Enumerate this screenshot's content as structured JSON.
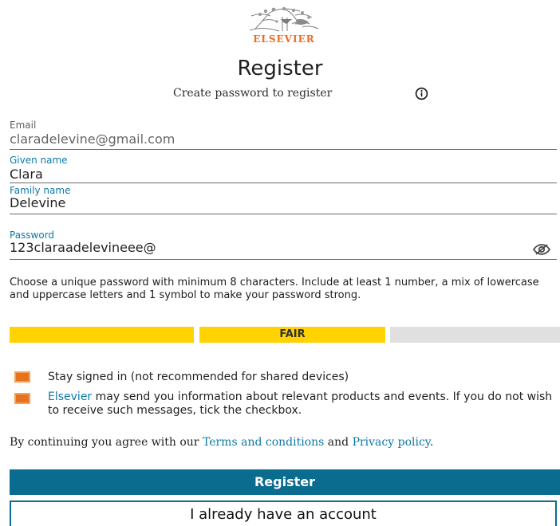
{
  "brand": {
    "name": "ELSEVIER",
    "logo_icon": "elsevier-tree-logo"
  },
  "header": {
    "title": "Register",
    "subtitle": "Create password to register"
  },
  "form": {
    "email": {
      "label": "Email",
      "value": "claradelevine@gmail.com"
    },
    "given_name": {
      "label": "Given name",
      "value": "Clara"
    },
    "family_name": {
      "label": "Family name",
      "value": "Delevine"
    },
    "password": {
      "label": "Password",
      "value": "123claraadelevineee@"
    }
  },
  "password_hint": "Choose a unique password with minimum 8 characters. Include at least 1 number, a mix of lowercase and uppercase letters and 1 symbol to make your password strong.",
  "password_strength": {
    "label": "FAIR",
    "active_segments": 2,
    "total_segments": 3,
    "color": "#ffd200",
    "empty_color": "#e0e0e0"
  },
  "checkboxes": {
    "stay_signed_in": {
      "label": "Stay signed in (not recommended for shared devices)"
    },
    "marketing": {
      "brand": "Elsevier",
      "rest": " may send you information about relevant products and events. If you do not wish to receive such messages, tick the checkbox."
    }
  },
  "agreement": {
    "prefix": "By continuing you agree with our ",
    "terms": "Terms and conditions",
    "middle": " and ",
    "privacy": "Privacy policy",
    "suffix": "."
  },
  "actions": {
    "register": "Register",
    "existing_account": "I already have an account"
  },
  "colors": {
    "primary": "#0a6c8f",
    "link": "#0d79a7",
    "accent": "#f06c22",
    "checkbox": "#e9711c"
  }
}
